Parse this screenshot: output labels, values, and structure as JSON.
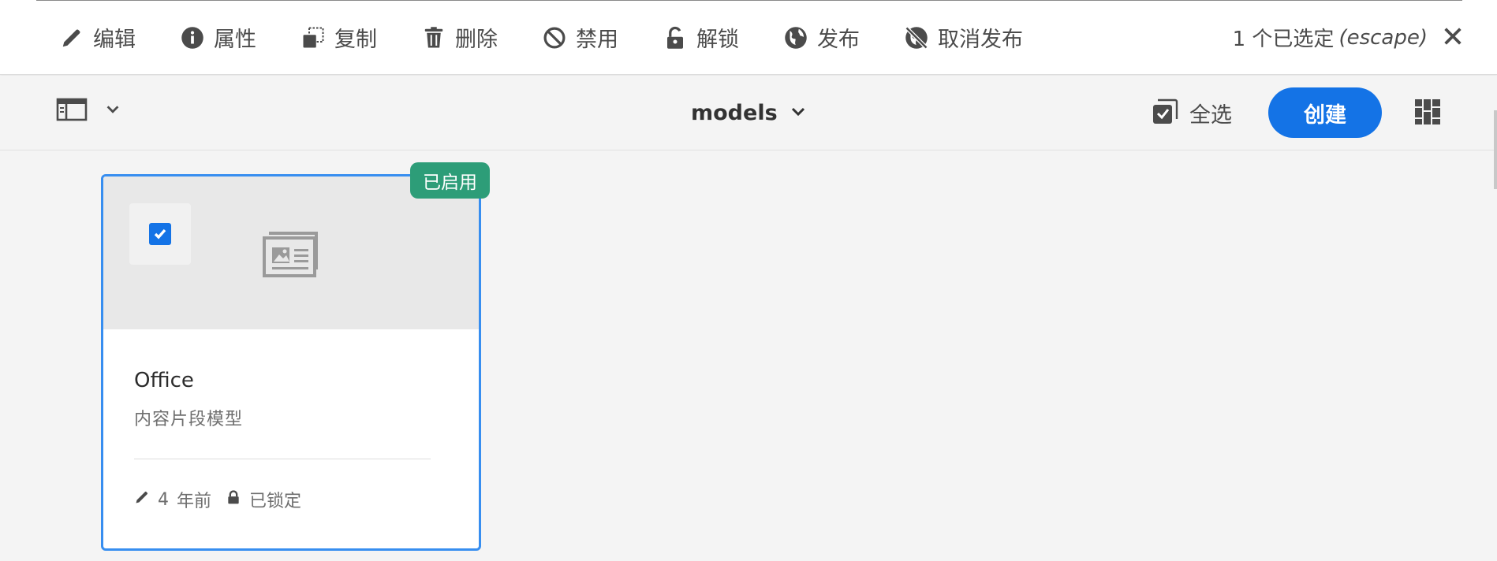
{
  "action_bar": {
    "actions": [
      {
        "label": "编辑",
        "icon": "pencil-icon"
      },
      {
        "label": "属性",
        "icon": "info-icon"
      },
      {
        "label": "复制",
        "icon": "copy-icon"
      },
      {
        "label": "删除",
        "icon": "trash-icon"
      },
      {
        "label": "禁用",
        "icon": "disable-icon"
      },
      {
        "label": "解锁",
        "icon": "unlock-icon"
      },
      {
        "label": "发布",
        "icon": "globe-icon"
      },
      {
        "label": "取消发布",
        "icon": "globe-strike-icon"
      }
    ],
    "selection_count": "1 个已选定",
    "escape_hint": "(escape)",
    "close_icon": "close-icon"
  },
  "header": {
    "folder_title": "models",
    "select_all": "全选",
    "create": "创建"
  },
  "card": {
    "status_badge": "已启用",
    "title": "Office",
    "subtitle": "内容片段模型",
    "modified_count": "4",
    "modified_unit": "年前",
    "lock_status": "已锁定",
    "checked": true
  },
  "colors": {
    "accent": "#1473e6",
    "badge_green": "#2d9d78",
    "selection_border": "#378ef0"
  }
}
